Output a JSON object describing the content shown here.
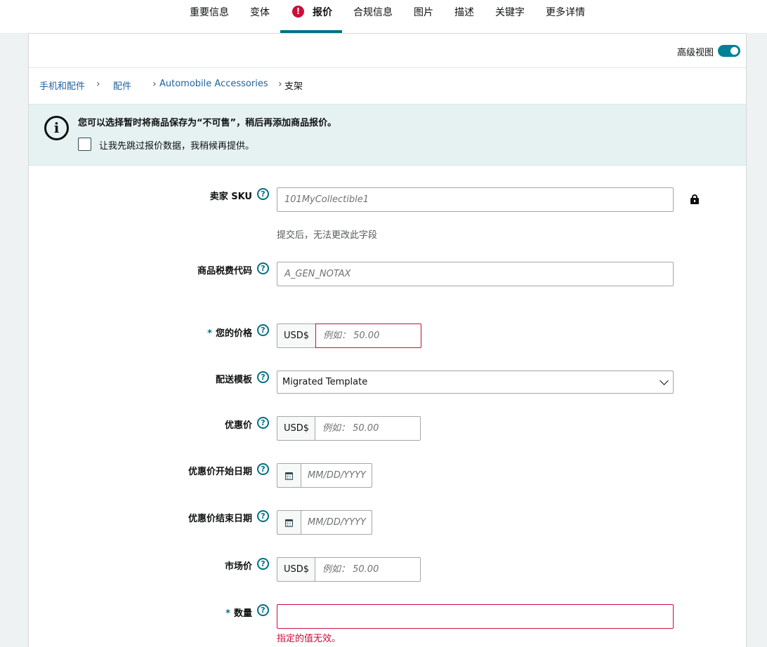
{
  "tabs": [
    {
      "label": "重要信息"
    },
    {
      "label": "变体"
    },
    {
      "label": "报价",
      "active": true,
      "error": true
    },
    {
      "label": "合规信息"
    },
    {
      "label": "图片"
    },
    {
      "label": "描述"
    },
    {
      "label": "关键字"
    },
    {
      "label": "更多详情"
    }
  ],
  "header": {
    "advanced_view_label": "高级视图",
    "advanced_view_on": true
  },
  "breadcrumb": [
    "手机和配件",
    "配件",
    "Automobile Accessories",
    "支架"
  ],
  "alert": {
    "icon": "info-icon",
    "title": "您可以选择暂时将商品保存为“不可售”，稍后再添加商品报价。",
    "checkbox_label": "让我先跳过报价数据，我稍候再提供。",
    "checkbox_checked": false
  },
  "form": {
    "seller_sku": {
      "label": "卖家 SKU",
      "placeholder": "101MyCollectible1",
      "hint": "提交后，无法更改此字段",
      "locked": true
    },
    "tax_code": {
      "label": "商品税费代码",
      "placeholder": "A_GEN_NOTAX"
    },
    "your_price": {
      "label": "您的价格",
      "required_mark": "*",
      "currency": "USD$",
      "placeholder": "例如： 50.00"
    },
    "shipping_template": {
      "label": "配送模板",
      "value": "Migrated Template"
    },
    "sale_price": {
      "label": "优惠价",
      "currency": "USD$",
      "placeholder": "例如： 50.00"
    },
    "sale_start": {
      "label": "优惠价开始日期",
      "placeholder": "MM/DD/YYYY"
    },
    "sale_end": {
      "label": "优惠价结束日期",
      "placeholder": "MM/DD/YYYY"
    },
    "list_price": {
      "label": "市场价",
      "currency": "USD$",
      "placeholder": "例如： 50.00"
    },
    "quantity": {
      "label": "数量",
      "required_mark": "*",
      "error": "指定的值无效。"
    }
  },
  "help_glyph": "?",
  "colors": {
    "accent": "#007185",
    "error": "#cc0c39",
    "alert_bg": "#e6f2f2"
  }
}
